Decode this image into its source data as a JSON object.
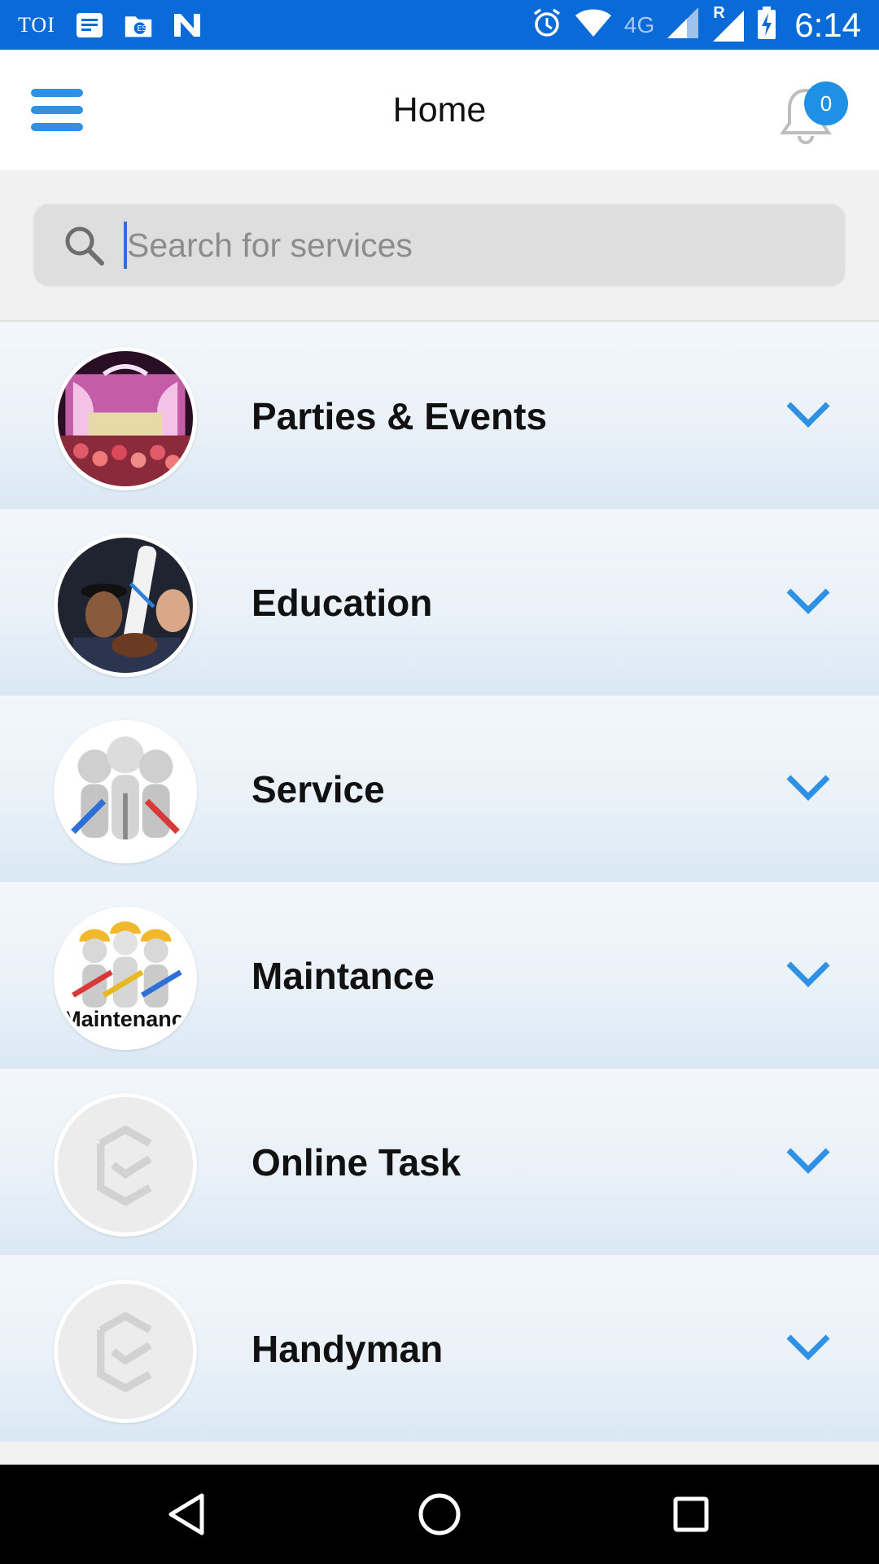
{
  "status_bar": {
    "left_label": "TOI",
    "network": "4G",
    "roaming": "R",
    "time": "6:14"
  },
  "header": {
    "title": "Home",
    "notification_count": "0"
  },
  "search": {
    "placeholder": "Search for services",
    "value": ""
  },
  "categories": [
    {
      "label": "Parties & Events",
      "icon": "party-stage-photo"
    },
    {
      "label": "Education",
      "icon": "graduates-photo"
    },
    {
      "label": "Service",
      "icon": "workers-with-tools"
    },
    {
      "label": "Maintance",
      "icon": "maintenance-workers"
    },
    {
      "label": "Online Task",
      "icon": "placeholder-logo"
    },
    {
      "label": "Handyman",
      "icon": "placeholder-logo"
    }
  ],
  "maintenance_image_text": "Maintenance",
  "colors": {
    "status_bar": "#0a6bd8",
    "accent": "#2e91e4",
    "badge": "#1e90e6"
  }
}
